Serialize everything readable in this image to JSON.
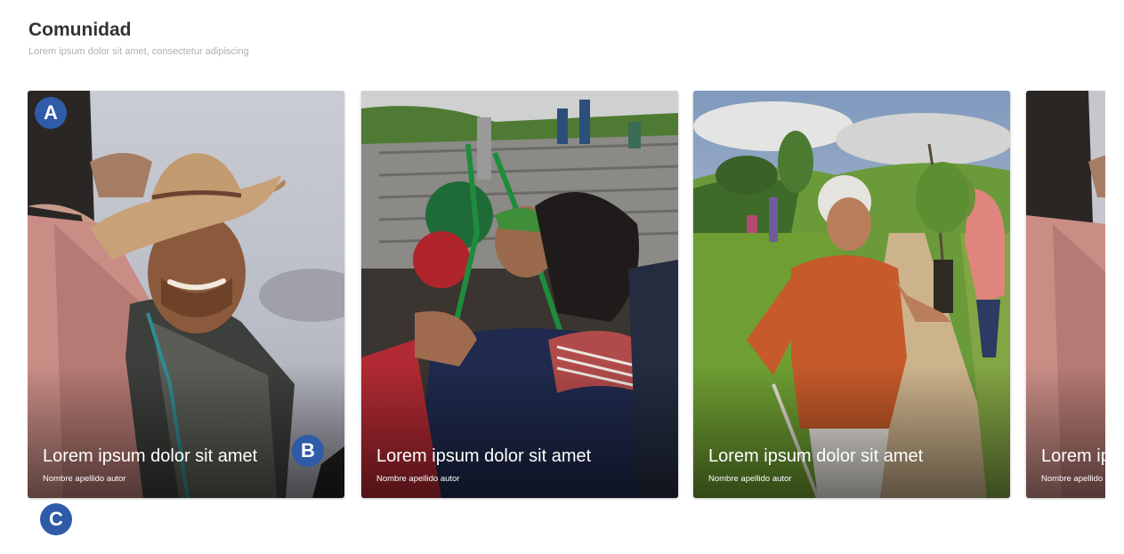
{
  "section": {
    "title": "Comunidad",
    "subtitle": "Lorem ipsum dolor sit amet, consectetur adipiscing"
  },
  "cards": [
    {
      "title": "Lorem ipsum dolor sit amet",
      "author": "Nombre apellido autor",
      "photo": "smiling-man-hat-photo"
    },
    {
      "title": "Lorem ipsum dolor sit amet",
      "author": "Nombre apellido autor",
      "photo": "embrace-ceremony-photo"
    },
    {
      "title": "Lorem ipsum dolor sit amet",
      "author": "Nombre apellido autor",
      "photo": "woman-holding-seedling-photo"
    },
    {
      "title": "Lorem ipsum dolor sit amet",
      "author": "Nombre apellido autor",
      "photo": "smiling-man-hat-photo"
    }
  ],
  "markers": {
    "a": "A",
    "b": "B",
    "c": "C"
  },
  "colors": {
    "marker": "#2f5ba8",
    "title": "#333333",
    "subtitle": "#b0b0b0"
  }
}
